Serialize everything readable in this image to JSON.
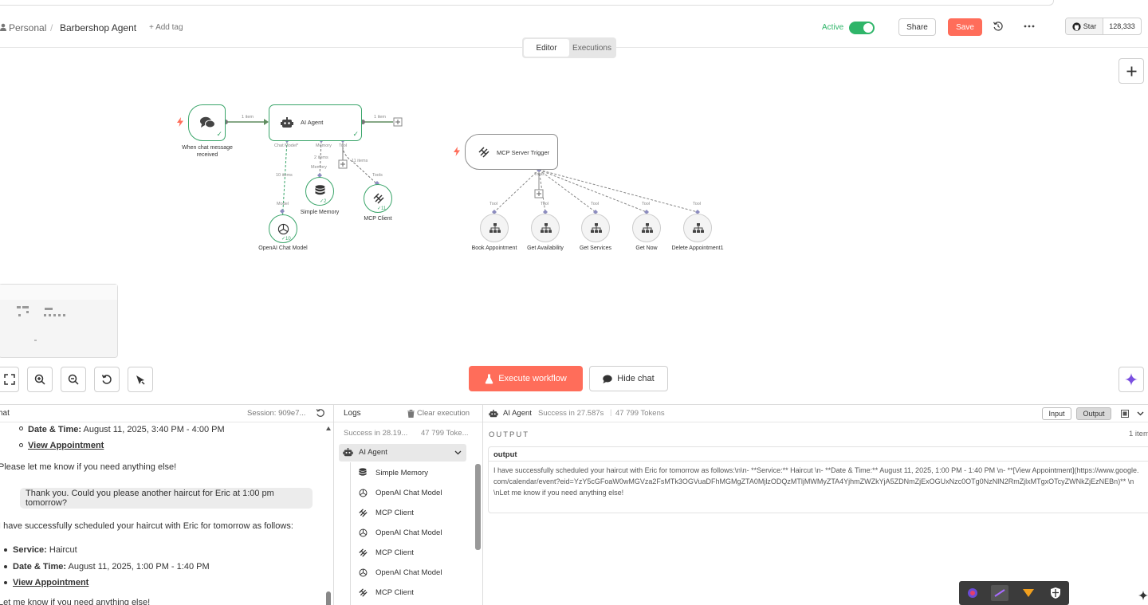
{
  "header": {
    "breadcrumb_project": "Personal",
    "breadcrumb_separator": "/",
    "workflow_name": "Barbershop Agent",
    "add_tag": "+ Add tag",
    "active_label": "Active",
    "share_label": "Share",
    "save_label": "Save",
    "star_label": "Star",
    "star_count": "128,333"
  },
  "tabs": [
    "Editor",
    "Executions"
  ],
  "canvas": {
    "nodes": {
      "chat_trigger": "When chat message received",
      "ai_agent": "AI Agent",
      "simple_memory": "Simple Memory",
      "mcp_client": "MCP Client",
      "openai_model": "OpenAI Chat Model",
      "mcp_trigger": "MCP Server Trigger",
      "book": "Book Appointment",
      "availability": "Get Availability",
      "services": "Get Services",
      "now": "Get Now",
      "delete": "Delete Appointment1"
    },
    "edge_labels": {
      "item_in": "1 item",
      "item_out": "1 item",
      "chat_model": "Chat Model*",
      "memory": "Memory",
      "tool": "Tool",
      "model_items": "10 items",
      "memory_items": "2 items",
      "tool_items": "11 items",
      "model_port": "Model",
      "memory_port": "Memory",
      "tools_port": "Tools",
      "tool_port": "Tool",
      "badge_memory": "2",
      "badge_mcp": "11",
      "badge_model": "10"
    }
  },
  "controls": {
    "execute_label": "Execute workflow",
    "hide_chat_label": "Hide chat"
  },
  "chat": {
    "title": "hat",
    "session": "Session: 909e7...",
    "line1_label": "Date & Time:",
    "line1_value": " August 11, 2025, 3:40 PM - 4:00 PM",
    "link1": "View Appointment",
    "line2": "Please let me know if you need anything else!",
    "user_msg": "Thank you. Could you please another haircut for Eric at 1:00 pm tomorrow?",
    "line3": "I have successfully scheduled your haircut with Eric for tomorrow as follows:",
    "service_label": "Service:",
    "service_value": " Haircut",
    "dt_label": "Date & Time:",
    "dt_value": " August 11, 2025, 1:00 PM - 1:40 PM",
    "link2": "View Appointment",
    "line4": "Let me know if you need anything else!"
  },
  "logs": {
    "title": "Logs",
    "clear": "Clear execution",
    "summary_status": "Success in 28.19...",
    "summary_tokens": "47 799 Toke...",
    "root": "AI Agent",
    "items": [
      "Simple Memory",
      "OpenAI Chat Model",
      "MCP Client",
      "OpenAI Chat Model",
      "MCP Client",
      "OpenAI Chat Model",
      "MCP Client"
    ]
  },
  "output": {
    "node": "AI Agent",
    "status": "Success in 27.587s",
    "tokens": "47 799 Tokens",
    "input_btn": "Input",
    "output_btn": "Output",
    "section": "OUTPUT",
    "count": "1 item",
    "field": "output",
    "text": "I have successfully scheduled your haircut with Eric for tomorrow as follows:\\n\\n- **Service:** Haircut \\n- **Date & Time:** August 11, 2025, 1:00 PM - 1:40 PM \\n- **[View Appointment](https://www.google.com/calendar/event?eid=YzY5cGFoaW0wMGVza2FsMTk3OGVuaDFhMGMgZTA0MjlzODQzMTljMWMyZTA4YjhmZWZkYjA5ZDNmZjExOGUxNzc0OTg0NzNlN2RmZjlxMTgxOTcyZWNkZjEzNEBn)** \\n\\nLet me know if you need anything else!"
  },
  "colors": {
    "accent": "#ff6d5a",
    "active": "#2fb569",
    "trigger": "#ff6d5a"
  }
}
